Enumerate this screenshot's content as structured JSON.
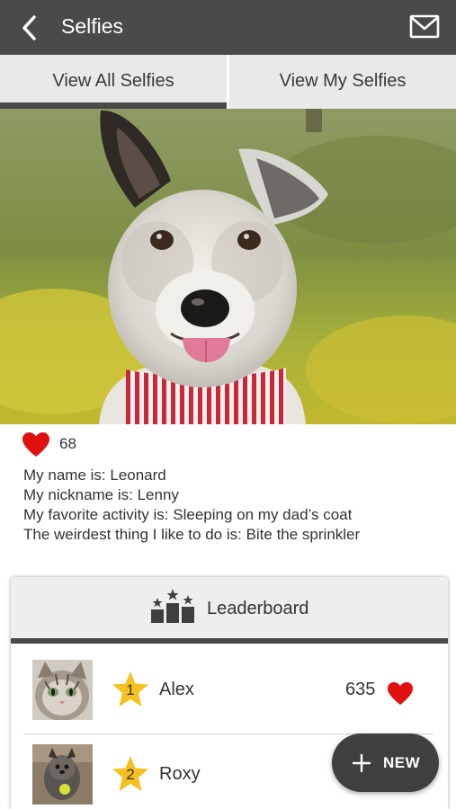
{
  "header": {
    "title": "Selfies",
    "back_icon": "back-arrow-icon",
    "mail_icon": "mail-icon"
  },
  "tabs": [
    {
      "label": "View All Selfies",
      "active": true
    },
    {
      "label": "View My Selfies",
      "active": false
    }
  ],
  "selfie": {
    "image": "dog-photo",
    "likes": "68",
    "bio": [
      "My name is: Leonard",
      "My nickname is: Lenny",
      "My favorite activity is: Sleeping on my dad’s coat",
      "The weirdest thing I like to do is: Bite the sprinkler"
    ]
  },
  "leaderboard": {
    "title": "Leaderboard",
    "icon": "podium-icon",
    "entries": [
      {
        "rank": "1",
        "name": "Alex",
        "score": "635",
        "thumb": "cat-photo"
      },
      {
        "rank": "2",
        "name": "Roxy",
        "score": "",
        "thumb": "dog-photo-small"
      }
    ]
  },
  "fab": {
    "label": "NEW",
    "icon": "plus-icon"
  },
  "colors": {
    "topbar": "#4a4a4a",
    "tab_bg": "#e9e9e9",
    "heart": "#e01010",
    "star": "#f5c020",
    "fab_bg": "#3f3f3f"
  }
}
